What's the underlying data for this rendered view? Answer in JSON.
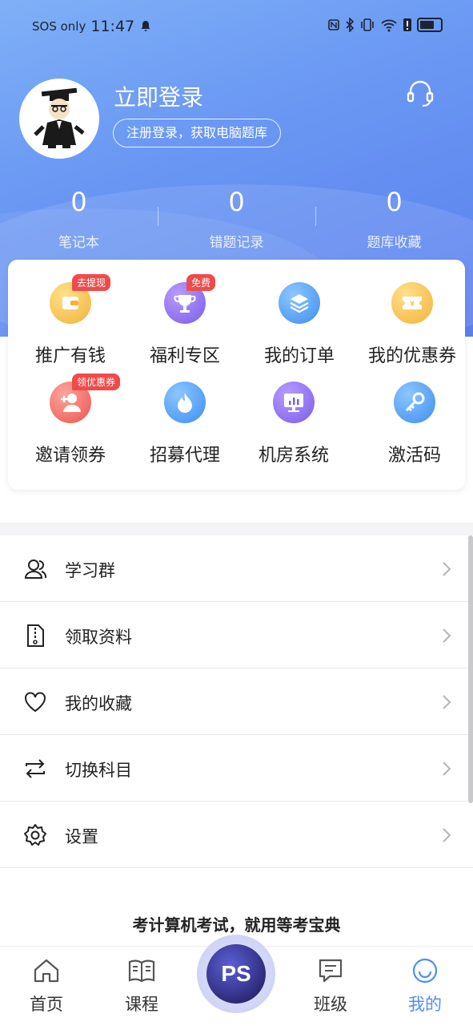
{
  "status_bar": {
    "carrier": "SOS only",
    "time": "11:47"
  },
  "profile": {
    "login_title": "立即登录",
    "login_subtitle": "注册登录，获取电脑题库",
    "avatar_icon": "scholar-avatar-icon",
    "support_icon": "headset-icon"
  },
  "stats": [
    {
      "value": "0",
      "label": "笔记本"
    },
    {
      "value": "0",
      "label": "错题记录"
    },
    {
      "value": "0",
      "label": "题库收藏"
    }
  ],
  "features": [
    {
      "label": "推广有钱",
      "badge": "去提现",
      "icon": "wallet-icon",
      "color": "#f5b544"
    },
    {
      "label": "福利专区",
      "badge": "免费",
      "icon": "trophy-icon",
      "color": "#8c6cf0"
    },
    {
      "label": "我的订单",
      "badge": "",
      "icon": "layers-icon",
      "color": "#4f9cf2"
    },
    {
      "label": "我的优惠券",
      "badge": "",
      "icon": "coupon-icon",
      "color": "#f6b544"
    },
    {
      "label": "邀请领券",
      "badge": "领优惠券",
      "icon": "add-user-icon",
      "color": "#ef6a62"
    },
    {
      "label": "招募代理",
      "badge": "",
      "icon": "flame-icon",
      "color": "#4f9cf2"
    },
    {
      "label": "机房系统",
      "badge": "",
      "icon": "monitor-icon",
      "color": "#8c6cf0"
    },
    {
      "label": "激活码",
      "badge": "",
      "icon": "key-icon",
      "color": "#4f9cf2"
    }
  ],
  "menu": [
    {
      "label": "学习群",
      "icon": "group-icon"
    },
    {
      "label": "领取资料",
      "icon": "file-icon"
    },
    {
      "label": "我的收藏",
      "icon": "heart-icon"
    },
    {
      "label": "切换科目",
      "icon": "switch-icon"
    },
    {
      "label": "设置",
      "icon": "gear-icon"
    }
  ],
  "slogan": "考计算机考试，就用等考宝典",
  "tabs": [
    {
      "label": "首页",
      "icon": "home-icon",
      "active": false
    },
    {
      "label": "课程",
      "icon": "book-icon",
      "active": false
    },
    {
      "label": "PS",
      "icon": "ps-logo-icon",
      "active": false
    },
    {
      "label": "班级",
      "icon": "message-icon",
      "active": false
    },
    {
      "label": "我的",
      "icon": "smile-icon",
      "active": true
    }
  ],
  "colors": {
    "accent": "#4f8ff5",
    "hero_top": "#7fb0f7",
    "hero_bottom": "#5b80ee",
    "badge": "#ef4b4b"
  }
}
